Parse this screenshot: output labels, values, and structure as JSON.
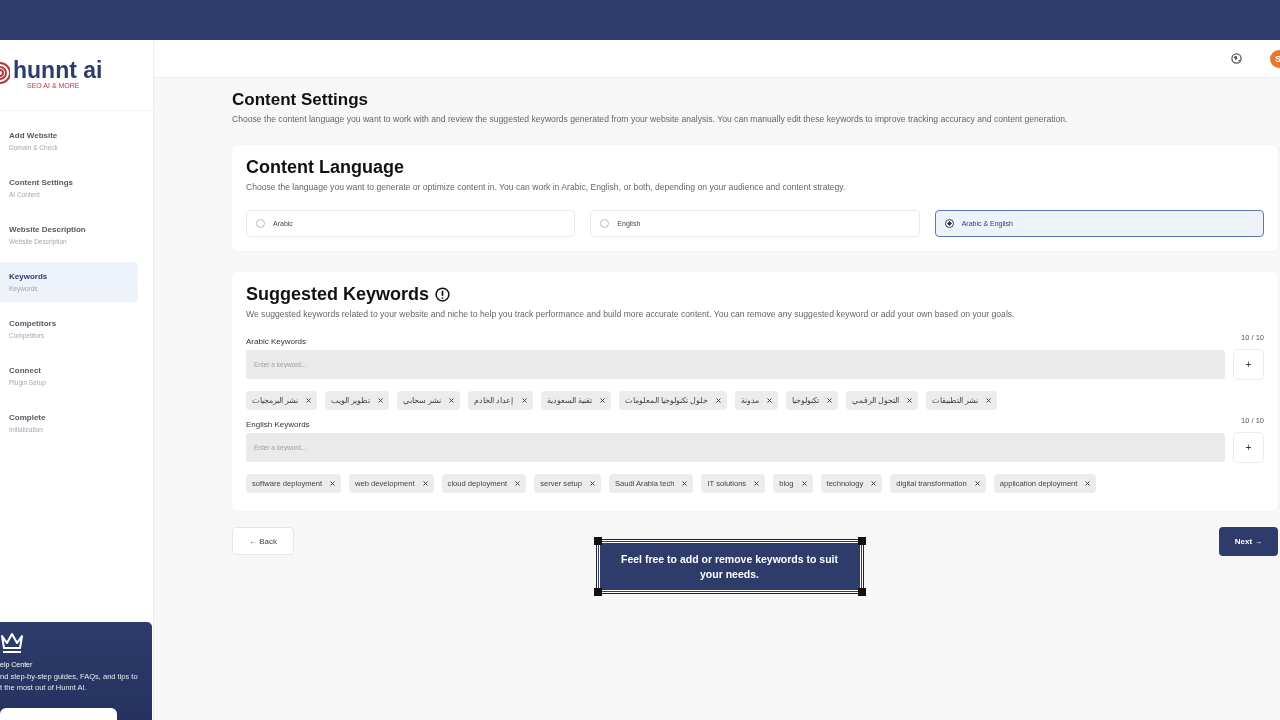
{
  "sidebar": {
    "logo": {
      "name": "hunnt ai",
      "tagline": "SEO AI & MORE"
    },
    "steps": [
      {
        "title": "Add Website",
        "subtitle": "Domain & Check",
        "selected": false
      },
      {
        "title": "Content Settings",
        "subtitle": "AI Content",
        "selected": false
      },
      {
        "title": "Website Description",
        "subtitle": "Website Description",
        "selected": false
      },
      {
        "title": "Keywords",
        "subtitle": "Keywords",
        "selected": true
      },
      {
        "title": "Competitors",
        "subtitle": "Competitors",
        "selected": false
      },
      {
        "title": "Connect",
        "subtitle": "Plugin Setup",
        "selected": false
      },
      {
        "title": "Complete",
        "subtitle": "Initialization",
        "selected": false
      }
    ],
    "help_card": {
      "title": "elp Center",
      "lines": [
        "nd step-by-step guides, FAQs, and tips to",
        "t the most out of Hunnt AI."
      ]
    }
  },
  "header": {
    "avatar": "S"
  },
  "page": {
    "title": "Content Settings",
    "description": "Choose the content language you want to work with and review the suggested keywords generated from your website analysis. You can manually edit these keywords to improve tracking accuracy and content generation."
  },
  "language_card": {
    "title": "Content Language",
    "description": "Choose the language you want to generate or optimize content in. You can work in Arabic, English, or both, depending on your audience and content strategy.",
    "options": [
      {
        "label": "Arabic",
        "selected": false
      },
      {
        "label": "English",
        "selected": false
      },
      {
        "label": "Arabic & English",
        "selected": true
      }
    ]
  },
  "keywords_card": {
    "title": "Suggested Keywords",
    "description": "We suggested keywords related to your website and niche to help you track performance and build more accurate content. You can remove any suggested keyword or add your own based on your goals.",
    "groups": [
      {
        "label": "Arabic Keywords",
        "count": "10 / 10",
        "placeholder": "Enter a keyword...",
        "add": "+",
        "rtl": true,
        "keywords": [
          "نشر التطبيقات",
          "التحول الرقمي",
          "تكنولوجيا",
          "مدونة",
          "حلول تكنولوجيا المعلومات",
          "تقنية السعودية",
          "إعداد الخادم",
          "نشر سحابي",
          "تطوير الويب",
          "نشر البرمجيات"
        ]
      },
      {
        "label": "English Keywords",
        "count": "10 / 10",
        "placeholder": "Enter a keyword...",
        "add": "+",
        "rtl": false,
        "keywords": [
          "software deployment",
          "web development",
          "cloud deployment",
          "server setup",
          "Saudi Arabia tech",
          "IT solutions",
          "blog",
          "technology",
          "digital transformation",
          "application deployment"
        ]
      }
    ]
  },
  "buttons": {
    "back": "← Back",
    "next": "Next →"
  },
  "callout": {
    "text": "Feel free to add or remove keywords to suit your needs."
  }
}
